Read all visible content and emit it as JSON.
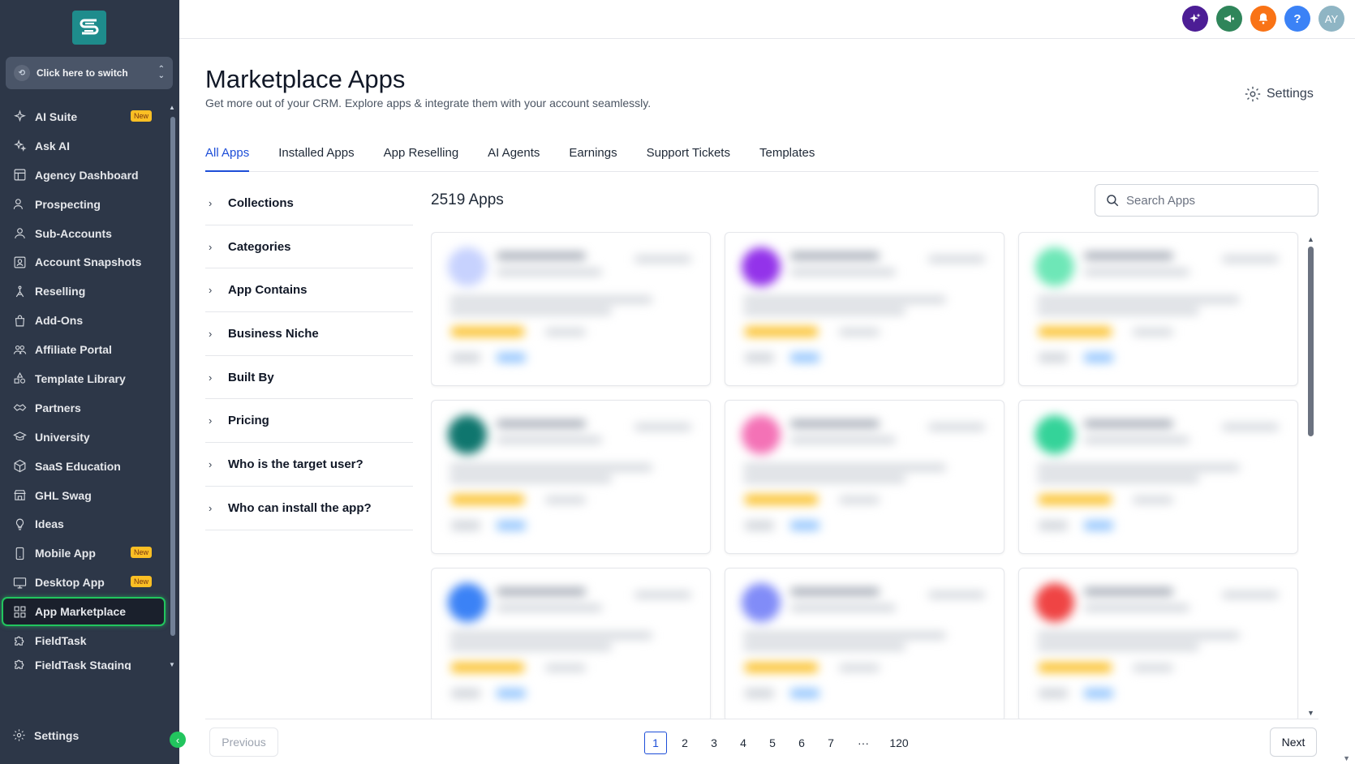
{
  "sidebar": {
    "switcher_label": "Click here to switch",
    "items": [
      {
        "name": "ai-suite",
        "label": "AI Suite",
        "icon": "sparkle-icon",
        "badge": "New"
      },
      {
        "name": "ask-ai",
        "label": "Ask AI",
        "icon": "sparkles-icon"
      },
      {
        "name": "agency-dashboard",
        "label": "Agency Dashboard",
        "icon": "dashboard-icon"
      },
      {
        "name": "prospecting",
        "label": "Prospecting",
        "icon": "users-icon"
      },
      {
        "name": "sub-accounts",
        "label": "Sub-Accounts",
        "icon": "user-icon"
      },
      {
        "name": "account-snapshots",
        "label": "Account Snapshots",
        "icon": "snapshot-icon"
      },
      {
        "name": "reselling",
        "label": "Reselling",
        "icon": "reselling-icon"
      },
      {
        "name": "add-ons",
        "label": "Add-Ons",
        "icon": "bag-icon"
      },
      {
        "name": "affiliate-portal",
        "label": "Affiliate Portal",
        "icon": "group-icon"
      },
      {
        "name": "template-library",
        "label": "Template Library",
        "icon": "shapes-icon"
      },
      {
        "name": "partners",
        "label": "Partners",
        "icon": "handshake-icon"
      },
      {
        "name": "university",
        "label": "University",
        "icon": "graduation-cap-icon"
      },
      {
        "name": "saas-education",
        "label": "SaaS Education",
        "icon": "cube-icon"
      },
      {
        "name": "ghl-swag",
        "label": "GHL Swag",
        "icon": "store-icon"
      },
      {
        "name": "ideas",
        "label": "Ideas",
        "icon": "lightbulb-icon"
      },
      {
        "name": "mobile-app",
        "label": "Mobile App",
        "icon": "phone-icon",
        "badge": "New"
      },
      {
        "name": "desktop-app",
        "label": "Desktop App",
        "icon": "monitor-icon",
        "badge": "New"
      },
      {
        "name": "app-marketplace",
        "label": "App Marketplace",
        "icon": "grid-icon",
        "active": true
      },
      {
        "name": "fieldtask",
        "label": "FieldTask",
        "icon": "puzzle-icon"
      },
      {
        "name": "fieldtask-staging",
        "label": "FieldTask Staging",
        "icon": "puzzle-icon",
        "cut": true
      }
    ],
    "settings_label": "Settings"
  },
  "topbar": {
    "icons": [
      {
        "name": "ai-sparkle-icon",
        "color": "#4c1d95"
      },
      {
        "name": "megaphone-icon",
        "color": "#2f855a"
      },
      {
        "name": "bell-icon",
        "color": "#f97316"
      },
      {
        "name": "help-icon",
        "color": "#3b82f6",
        "glyph": "?"
      },
      {
        "name": "avatar",
        "color": "#8fb5c4",
        "glyph": "AY"
      }
    ]
  },
  "main": {
    "title": "Marketplace Apps",
    "subtitle": "Get more out of your CRM. Explore apps & integrate them with your account seamlessly.",
    "settings_label": "Settings",
    "tabs": [
      "All Apps",
      "Installed Apps",
      "App Reselling",
      "AI Agents",
      "Earnings",
      "Support Tickets",
      "Templates"
    ],
    "active_tab": 0,
    "filters": [
      "Collections",
      "Categories",
      "App Contains",
      "Business Niche",
      "Built By",
      "Pricing",
      "Who is the target user?",
      "Who can install the app?"
    ],
    "apps_count": "2519 Apps",
    "search_placeholder": "Search Apps"
  },
  "cards": [
    {
      "icon_color": "#c7d2fe"
    },
    {
      "icon_color": "#9333ea"
    },
    {
      "icon_color": "#6ee7b7"
    },
    {
      "icon_color": "#0f766e"
    },
    {
      "icon_color": "#f472b6"
    },
    {
      "icon_color": "#34d399"
    },
    {
      "icon_color": "#3b82f6"
    },
    {
      "icon_color": "#818cf8"
    },
    {
      "icon_color": "#ef4444"
    }
  ],
  "pagination": {
    "previous_label": "Previous",
    "next_label": "Next",
    "pages": [
      "1",
      "2",
      "3",
      "4",
      "5",
      "6",
      "7",
      "···",
      "120"
    ],
    "current": "1"
  }
}
